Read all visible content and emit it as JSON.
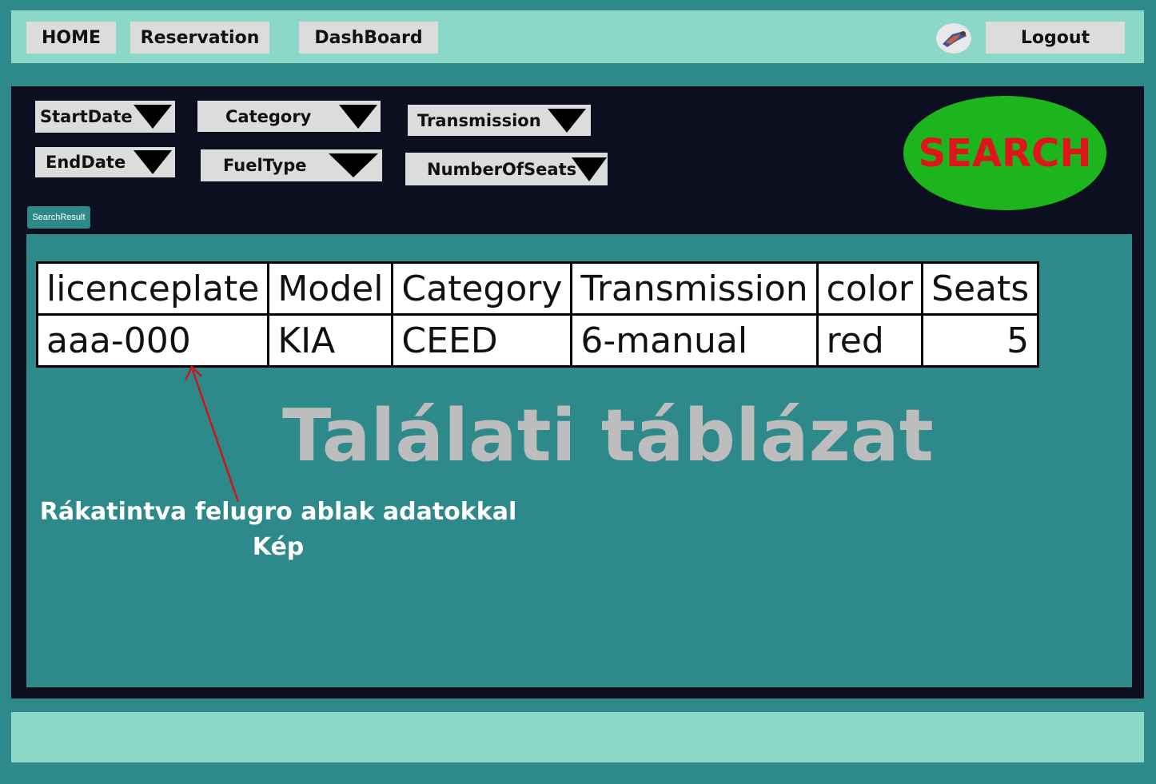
{
  "nav": {
    "home": "HOME",
    "reservation": "Reservation",
    "dashboard": "DashBoard",
    "logout": "Logout"
  },
  "filters": {
    "start_date": "StartDate",
    "end_date": "EndDate",
    "category": "Category",
    "fuel_type": "FuelType",
    "transmission": "Transmission",
    "number_of_seats": "NumberOfSeats"
  },
  "search_label": "SEARCH",
  "search_result_label": "SearchResult",
  "table": {
    "headers": [
      "licenceplate",
      "Model",
      "Category",
      "Transmission",
      "color",
      "Seats"
    ],
    "rows": [
      [
        "aaa-000",
        "KIA",
        "CEED",
        "6-manual",
        "red",
        "5"
      ]
    ]
  },
  "watermark": "Találati táblázat",
  "note": {
    "line1": "Rákatintva felugro ablak adatokkal",
    "line2": "Kép"
  },
  "colors": {
    "background": "#2e8a8a",
    "bar": "#8cd8c8",
    "panel_dark": "#0b0f20",
    "search_bg": "#1db51d",
    "search_text": "#e0151b",
    "arrow": "#d0141a"
  },
  "icons": {
    "avatar": "user-avatar",
    "dropdown": "triangle-down-icon"
  }
}
